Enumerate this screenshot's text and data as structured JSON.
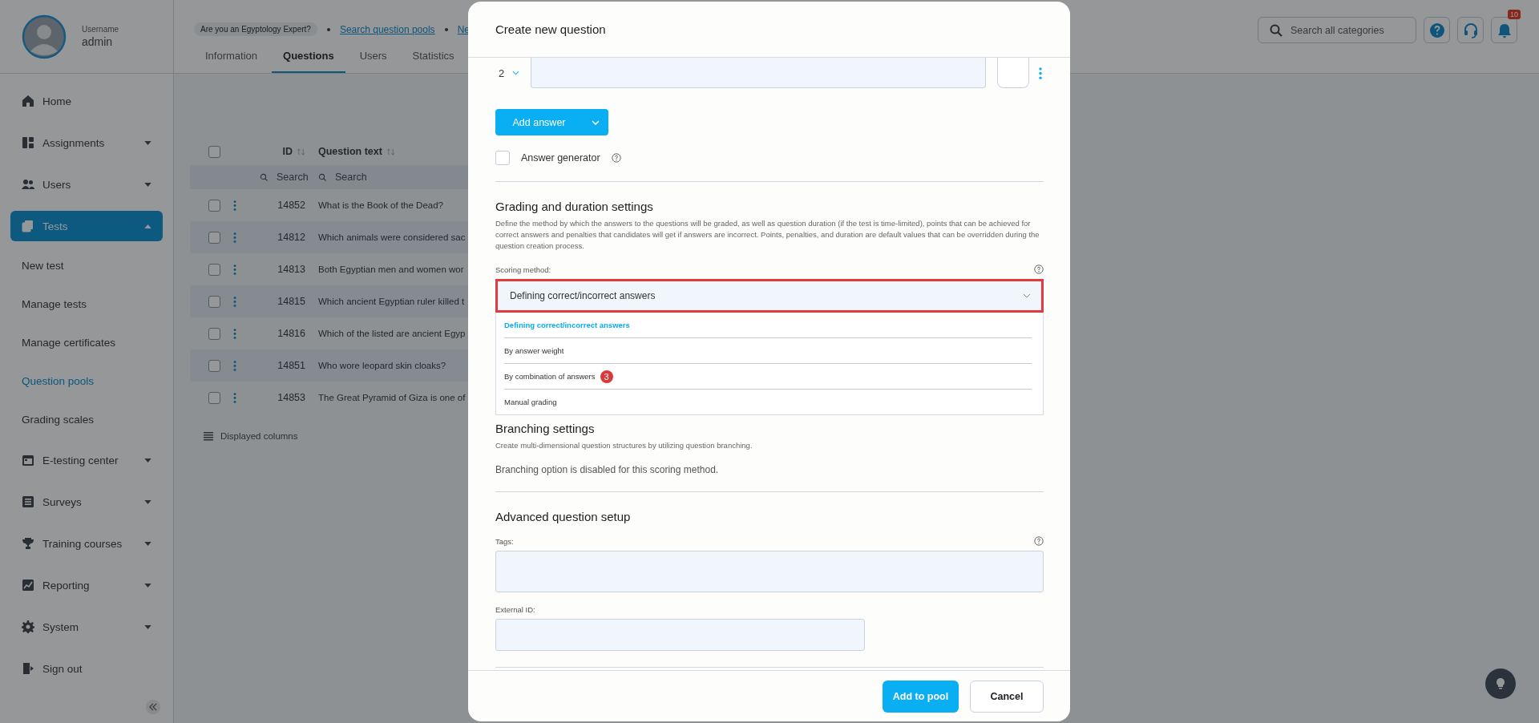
{
  "user": {
    "caption": "Username",
    "name": "admin"
  },
  "header": {
    "promo_chip": "Are you an Egyptology Expert?",
    "links": [
      {
        "label": "Search question pools"
      },
      {
        "label": "Ne"
      }
    ],
    "tabs": [
      {
        "label": "Information",
        "selected": false
      },
      {
        "label": "Questions",
        "selected": true
      },
      {
        "label": "Users",
        "selected": false
      },
      {
        "label": "Statistics",
        "selected": false
      }
    ]
  },
  "top_search": {
    "placeholder": "Search all categories"
  },
  "notifications": {
    "count": "10"
  },
  "sidebar": {
    "items": [
      {
        "label": "Home",
        "selected": false
      },
      {
        "label": "Assignments",
        "selected": false,
        "expanded": false
      },
      {
        "label": "Users",
        "selected": false,
        "expanded": false
      },
      {
        "label": "Tests",
        "selected": true,
        "expanded": true,
        "children": [
          {
            "label": "New test",
            "selected": false
          },
          {
            "label": "Manage tests",
            "selected": false
          },
          {
            "label": "Manage certificates",
            "selected": false
          },
          {
            "label": "Question pools",
            "selected": true
          },
          {
            "label": "Grading scales",
            "selected": false
          }
        ]
      },
      {
        "label": "E-testing center",
        "selected": false,
        "expanded": false
      },
      {
        "label": "Surveys",
        "selected": false,
        "expanded": false
      },
      {
        "label": "Training courses",
        "selected": false,
        "expanded": false
      },
      {
        "label": "Reporting",
        "selected": false,
        "expanded": false
      },
      {
        "label": "System",
        "selected": false,
        "expanded": false
      },
      {
        "label": "Sign out",
        "selected": false
      }
    ]
  },
  "table": {
    "select_all": {
      "checked": false
    },
    "columns": [
      {
        "label": "ID"
      },
      {
        "label": "Question text"
      }
    ],
    "search": [
      {
        "placeholder": "Search"
      },
      {
        "placeholder": "Search"
      }
    ],
    "rows": [
      {
        "id": "14852",
        "text": "What is the Book of the Dead?",
        "checked": false
      },
      {
        "id": "14812",
        "text": "Which animals were considered sac",
        "checked": false
      },
      {
        "id": "14813",
        "text": "Both Egyptian men and women wor",
        "checked": false
      },
      {
        "id": "14815",
        "text": "Which ancient Egyptian ruler killed t",
        "checked": false
      },
      {
        "id": "14816",
        "text": "Which of the listed are ancient Egyp",
        "checked": false
      },
      {
        "id": "14851",
        "text": "Who wore leopard skin cloaks?",
        "checked": false
      },
      {
        "id": "14853",
        "text": "The Great Pyramid of Giza is one of",
        "checked": false
      }
    ],
    "footer": "Displayed columns"
  },
  "modal": {
    "title": "Create new question",
    "answer": {
      "number": "2"
    },
    "add_answer": "Add answer",
    "answer_generator": {
      "label": "Answer generator",
      "checked": false
    },
    "grading": {
      "heading": "Grading and duration settings",
      "description": "Define the method by which the answers to the questions will be graded, as well as question duration (if the test is time-limited), points that can be achieved for correct answers and penalties that candidates will get if answers are incorrect. Points, penalties, and duration are default values that can be overridden during the question creation process.",
      "scoring_label": "Scoring method:",
      "scoring_value": "Defining correct/incorrect answers",
      "highlighted": true,
      "expanded": true,
      "options": [
        {
          "label": "Defining correct/incorrect answers",
          "selected": true
        },
        {
          "label": "By answer weight",
          "selected": false
        },
        {
          "label": "By combination of answers",
          "selected": false,
          "badge": "3"
        },
        {
          "label": "Manual grading",
          "selected": false
        }
      ]
    },
    "branching": {
      "heading": "Branching settings",
      "description": "Create multi-dimensional question structures by utilizing question branching.",
      "note": "Branching option is disabled for this scoring method."
    },
    "advanced": {
      "heading": "Advanced question setup",
      "tags_label": "Tags:",
      "external_id_label": "External ID:"
    },
    "buttons": {
      "primary": "Add to pool",
      "secondary": "Cancel"
    }
  }
}
